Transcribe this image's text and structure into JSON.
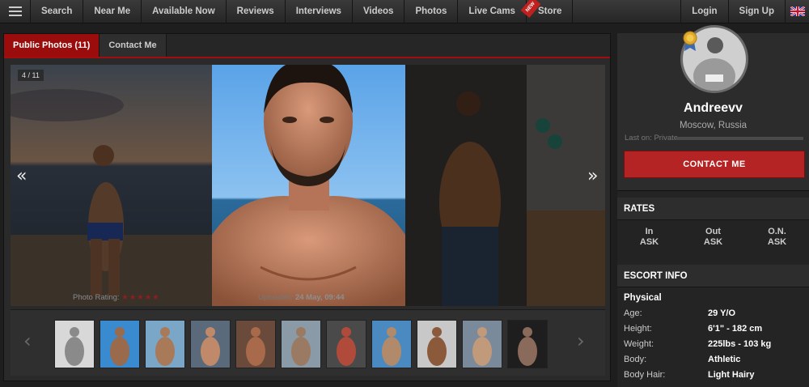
{
  "nav": {
    "items": [
      "Search",
      "Near Me",
      "Available Now",
      "Reviews",
      "Interviews",
      "Videos",
      "Photos",
      "Live Cams",
      "Store"
    ],
    "store_ribbon": "NEW",
    "login": "Login",
    "signup": "Sign Up",
    "language_icon": "uk-flag-icon"
  },
  "tabs": {
    "public_photos": "Public Photos (11)",
    "contact_me": "Contact Me"
  },
  "gallery": {
    "counter": "4 / 11",
    "prev_arrow": "«",
    "next_arrow": "»",
    "rating_label": "Photo Rating:",
    "rating_stars": "★★★★★",
    "uploaded_label": "Uploaded:",
    "uploaded_value": "24 May, 09:44"
  },
  "thumbnails": {
    "count": 11,
    "prev_arrow": "‹",
    "next_arrow": "›"
  },
  "profile": {
    "name": "Andreevv",
    "location": "Moscow, Russia",
    "last_on_label": "Last on:",
    "last_on_value": "Private",
    "contact_button": "CONTACT ME"
  },
  "rates": {
    "title": "RATES",
    "columns": [
      {
        "label": "In",
        "value": "ASK"
      },
      {
        "label": "Out",
        "value": "ASK"
      },
      {
        "label": "O.N.",
        "value": "ASK"
      }
    ]
  },
  "escort_info": {
    "title": "ESCORT INFO",
    "physical_title": "Physical",
    "rows": [
      {
        "key": "Age:",
        "value": "29 Y/O"
      },
      {
        "key": "Height:",
        "value": "6'1\" - 182 cm"
      },
      {
        "key": "Weight:",
        "value": "225lbs - 103 kg"
      },
      {
        "key": "Body:",
        "value": "Athletic"
      },
      {
        "key": "Body Hair:",
        "value": "Light Hairy"
      }
    ]
  },
  "colors": {
    "accent_red": "#b52424",
    "tab_active": "#9b0c0c"
  }
}
